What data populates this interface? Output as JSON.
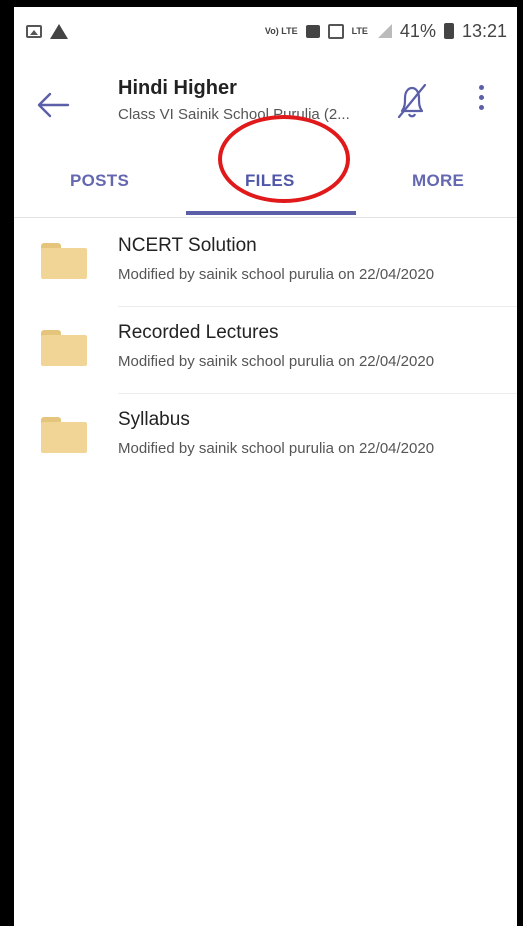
{
  "status_bar": {
    "volte_label": "Vo) LTE",
    "lte_label": "LTE",
    "battery_percent": "41%",
    "time": "13:21"
  },
  "header": {
    "title": "Hindi Higher",
    "subtitle": "Class VI Sainik School Purulia (2..."
  },
  "tabs": [
    {
      "label": "POSTS",
      "active": false
    },
    {
      "label": "FILES",
      "active": true
    },
    {
      "label": "MORE",
      "active": false
    }
  ],
  "files": [
    {
      "name": "NCERT Solution",
      "meta": "Modified by sainik school purulia on 22/04/2020"
    },
    {
      "name": "Recorded Lectures",
      "meta": "Modified by sainik school purulia on 22/04/2020"
    },
    {
      "name": "Syllabus",
      "meta": "Modified by sainik school purulia on 22/04/2020"
    }
  ],
  "colors": {
    "accent": "#5b5fa8",
    "folder": "#f0d596",
    "annotation": "#e0191b"
  }
}
